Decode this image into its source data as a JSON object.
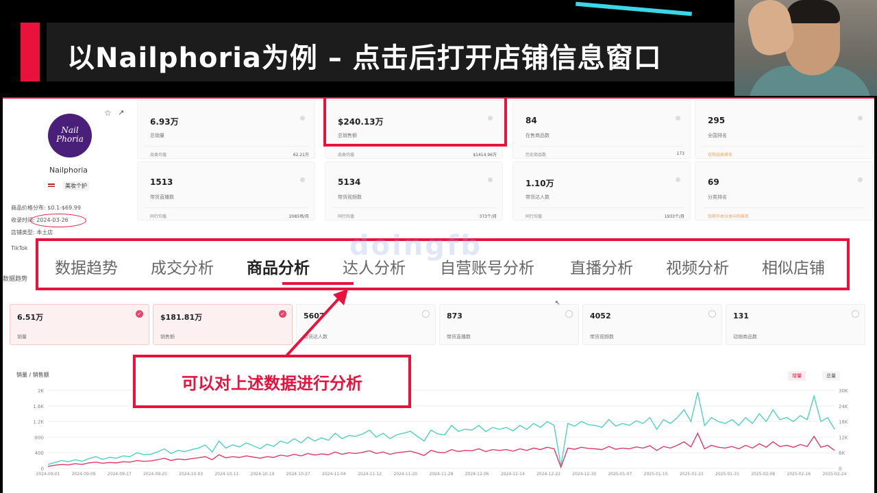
{
  "banner": {
    "title": "以Nailphoria为例 – 点击后打开店铺信息窗口",
    "accent_color": "#e8123d"
  },
  "shop": {
    "logo_text": "Nail Phoria",
    "name": "Nailphoria",
    "category": "美妆个护",
    "meta": [
      {
        "label": "商品价格分布:",
        "value": "$0.1-$69.99"
      },
      {
        "label": "收录时间:",
        "value": "2024-03-26"
      },
      {
        "label": "店铺类型:",
        "value": "本土店"
      },
      {
        "label": "TikTok",
        "value": ""
      }
    ]
  },
  "stats": [
    {
      "value": "6.93万",
      "label": "总销量",
      "foot_label": "品类均值",
      "foot_value": "62.21万"
    },
    {
      "value": "$240.13万",
      "label": "总销售额",
      "foot_label": "品类均值",
      "foot_value": "$1414.96万"
    },
    {
      "value": "84",
      "label": "在售商品数",
      "foot_label": "历史商品数",
      "foot_value": "173"
    },
    {
      "value": "295",
      "label": "全国排名",
      "foot_label": "仅限品类排名",
      "foot_value": ""
    },
    {
      "value": "1513",
      "label": "带货直播数",
      "foot_label": "同行均值",
      "foot_value": "2085场/月"
    },
    {
      "value": "5134",
      "label": "带货视频数",
      "foot_label": "同行均值",
      "foot_value": "373个/月"
    },
    {
      "value": "1.10万",
      "label": "带货达人数",
      "foot_label": "同行均值",
      "foot_value": "1933个/月"
    },
    {
      "value": "69",
      "label": "分类排名",
      "foot_label": "仅限于本分类中的排名",
      "foot_value": ""
    }
  ],
  "tabs": [
    "数据趋势",
    "成交分析",
    "商品分析",
    "达人分析",
    "自营账号分析",
    "直播分析",
    "视频分析",
    "相似店铺"
  ],
  "active_tab": "商品分析",
  "watermark": "doingfb",
  "section_label": "数据趋势",
  "metrics": [
    {
      "value": "6.51万",
      "label": "销量",
      "selected": true
    },
    {
      "value": "$181.81万",
      "label": "销售额",
      "selected": true
    },
    {
      "value": "5607",
      "label": "带货达人数",
      "selected": false
    },
    {
      "value": "873",
      "label": "带货直播数",
      "selected": false
    },
    {
      "value": "4052",
      "label": "带货视频数",
      "selected": false
    },
    {
      "value": "131",
      "label": "动销商品数",
      "selected": false
    }
  ],
  "callout": "可以对上述数据进行分析",
  "chart_toggle": {
    "a": "增量",
    "b": "总量"
  },
  "chart_data": {
    "type": "line",
    "title": "销量 / 销售额",
    "y_left_ticks": [
      "0",
      "400",
      "800",
      "1.2K",
      "1.6K",
      "2K"
    ],
    "y_right_ticks": [
      "0",
      "6K",
      "12K",
      "18K",
      "24K",
      "30K"
    ],
    "ylim_left": [
      0,
      2000
    ],
    "ylim_right": [
      0,
      30000
    ],
    "x_ticks": [
      "2024-09-01",
      "2024-09-09",
      "2024-09-17",
      "2024-09-25",
      "2024-10-03",
      "2024-10-11",
      "2024-10-19",
      "2024-10-27",
      "2024-11-04",
      "2024-11-12",
      "2024-11-20",
      "2024-11-28",
      "2024-12-06",
      "2024-12-14",
      "2024-12-22",
      "2024-12-30",
      "2025-01-07",
      "2025-01-15",
      "2025-01-23",
      "2025-01-31",
      "2025-02-08",
      "2025-02-16",
      "2025-02-24"
    ],
    "series": [
      {
        "color": "#4fd0c4",
        "values": [
          100,
          150,
          200,
          170,
          220,
          180,
          250,
          300,
          230,
          280,
          260,
          320,
          300,
          400,
          350,
          360,
          420,
          500,
          380,
          460,
          430,
          480,
          520,
          600,
          420,
          700,
          520,
          600,
          550,
          650,
          580,
          500,
          620,
          560,
          700,
          640,
          760,
          650,
          800,
          700,
          780,
          720,
          900,
          760,
          840,
          820,
          880,
          980,
          800,
          900,
          760,
          860,
          900,
          950,
          820,
          700,
          980,
          880,
          860,
          1100,
          950,
          1000,
          980,
          1100,
          940,
          1050,
          1000,
          1050,
          960,
          1100,
          1000,
          1150,
          1050,
          1200,
          1100,
          60,
          1150,
          1080,
          1200,
          1120,
          1100,
          1050,
          1250,
          1080,
          1150,
          1100,
          1220,
          1150,
          1300,
          1000,
          1250,
          1150,
          1300,
          1500,
          1200,
          1950,
          1100,
          1300,
          1200,
          1150,
          1250,
          1100,
          1300,
          1150,
          1400,
          1200,
          1500,
          1250,
          1300,
          1200,
          1350,
          1250,
          1850,
          1200,
          1300,
          1000
        ]
      },
      {
        "color": "#e03a67",
        "values": [
          50,
          80,
          100,
          90,
          120,
          100,
          140,
          160,
          130,
          150,
          140,
          170,
          160,
          200,
          180,
          190,
          220,
          260,
          200,
          240,
          220,
          250,
          270,
          300,
          220,
          350,
          270,
          300,
          280,
          320,
          290,
          260,
          300,
          280,
          340,
          310,
          360,
          320,
          380,
          340,
          370,
          350,
          420,
          360,
          400,
          380,
          410,
          450,
          380,
          420,
          360,
          400,
          420,
          440,
          390,
          330,
          460,
          410,
          400,
          480,
          430,
          460,
          450,
          500,
          430,
          480,
          460,
          480,
          440,
          500,
          460,
          520,
          480,
          540,
          500,
          30,
          520,
          490,
          540,
          510,
          500,
          480,
          560,
          490,
          520,
          500,
          550,
          520,
          580,
          460,
          560,
          520,
          590,
          680,
          550,
          900,
          500,
          590,
          540,
          520,
          560,
          500,
          590,
          520,
          630,
          540,
          680,
          560,
          590,
          540,
          610,
          560,
          820,
          540,
          590,
          460
        ]
      }
    ]
  }
}
